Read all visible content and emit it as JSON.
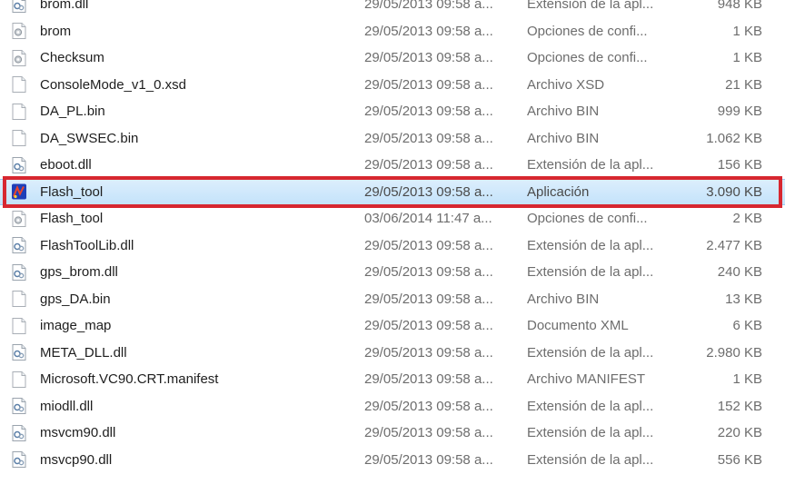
{
  "files": [
    {
      "name": "brom.dll",
      "date": "29/05/2013 09:58 a...",
      "type": "Extensión de la apl...",
      "size": "948 KB",
      "icon": "dll-icon"
    },
    {
      "name": "brom",
      "date": "29/05/2013 09:58 a...",
      "type": "Opciones de confi...",
      "size": "1 KB",
      "icon": "config-file-icon"
    },
    {
      "name": "Checksum",
      "date": "29/05/2013 09:58 a...",
      "type": "Opciones de confi...",
      "size": "1 KB",
      "icon": "config-file-icon"
    },
    {
      "name": "ConsoleMode_v1_0.xsd",
      "date": "29/05/2013 09:58 a...",
      "type": "Archivo XSD",
      "size": "21 KB",
      "icon": "blank-file-icon"
    },
    {
      "name": "DA_PL.bin",
      "date": "29/05/2013 09:58 a...",
      "type": "Archivo BIN",
      "size": "999 KB",
      "icon": "blank-file-icon"
    },
    {
      "name": "DA_SWSEC.bin",
      "date": "29/05/2013 09:58 a...",
      "type": "Archivo BIN",
      "size": "1.062 KB",
      "icon": "blank-file-icon"
    },
    {
      "name": "eboot.dll",
      "date": "29/05/2013 09:58 a...",
      "type": "Extensión de la apl...",
      "size": "156 KB",
      "icon": "dll-icon"
    },
    {
      "name": "Flash_tool",
      "date": "29/05/2013 09:58 a...",
      "type": "Aplicación",
      "size": "3.090 KB",
      "icon": "application-icon",
      "selected": true
    },
    {
      "name": "Flash_tool",
      "date": "03/06/2014 11:47 a...",
      "type": "Opciones de confi...",
      "size": "2 KB",
      "icon": "config-file-icon"
    },
    {
      "name": "FlashToolLib.dll",
      "date": "29/05/2013 09:58 a...",
      "type": "Extensión de la apl...",
      "size": "2.477 KB",
      "icon": "dll-icon"
    },
    {
      "name": "gps_brom.dll",
      "date": "29/05/2013 09:58 a...",
      "type": "Extensión de la apl...",
      "size": "240 KB",
      "icon": "dll-icon"
    },
    {
      "name": "gps_DA.bin",
      "date": "29/05/2013 09:58 a...",
      "type": "Archivo BIN",
      "size": "13 KB",
      "icon": "blank-file-icon"
    },
    {
      "name": "image_map",
      "date": "29/05/2013 09:58 a...",
      "type": "Documento XML",
      "size": "6 KB",
      "icon": "blank-file-icon"
    },
    {
      "name": "META_DLL.dll",
      "date": "29/05/2013 09:58 a...",
      "type": "Extensión de la apl...",
      "size": "2.980 KB",
      "icon": "dll-icon"
    },
    {
      "name": "Microsoft.VC90.CRT.manifest",
      "date": "29/05/2013 09:58 a...",
      "type": "Archivo MANIFEST",
      "size": "1 KB",
      "icon": "blank-file-icon"
    },
    {
      "name": "miodll.dll",
      "date": "29/05/2013 09:58 a...",
      "type": "Extensión de la apl...",
      "size": "152 KB",
      "icon": "dll-icon"
    },
    {
      "name": "msvcm90.dll",
      "date": "29/05/2013 09:58 a...",
      "type": "Extensión de la apl...",
      "size": "220 KB",
      "icon": "dll-icon"
    },
    {
      "name": "msvcp90.dll",
      "date": "29/05/2013 09:58 a...",
      "type": "Extensión de la apl...",
      "size": "556 KB",
      "icon": "dll-icon"
    }
  ],
  "colors": {
    "highlight_border": "#d72730",
    "selection": "#c4e3fb",
    "secondary_text": "#6d6d6d"
  }
}
